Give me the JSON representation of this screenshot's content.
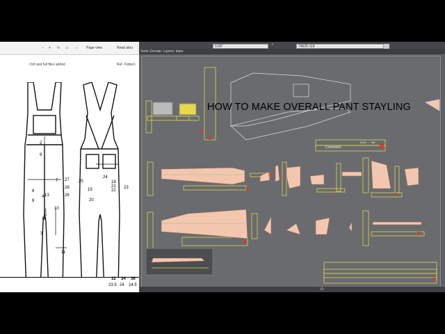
{
  "pdf_viewer": {
    "toolbar": {
      "page_view": "Page view",
      "read_aloud": "Read alou"
    },
    "header_left": "- Dxf and full files added",
    "header_right": "Ref. Pattern",
    "measure_labels": [
      "2",
      "9",
      "27",
      "6",
      "28",
      "8",
      "26",
      "10",
      "1",
      "3",
      "4",
      "5",
      "7",
      "11",
      "12",
      "13",
      "14",
      "20",
      "21",
      "22",
      "23",
      "25",
      "19",
      "24",
      "18"
    ],
    "size_table": {
      "headers": [
        "32",
        "34",
        "36"
      ],
      "row1": [
        "23.5",
        "24",
        "24.5"
      ]
    }
  },
  "cad": {
    "info_text": "Semi Circular: Layers: base",
    "field_value": "0.00\"",
    "field_value2": "74625-119",
    "comment_label": "Comment:",
    "acd_label": "ACD:",
    "ref_label": "ref:",
    "status_center": "15"
  },
  "overlay_title": "HOW TO MAKE OVERALL PANT STAYLING",
  "colors": {
    "piece": "#f3c6b0",
    "selected_piece": "#1a3cff",
    "frame": "#d8d84a",
    "marker": "#d43a3a",
    "canvas": "#6a6b6e"
  }
}
